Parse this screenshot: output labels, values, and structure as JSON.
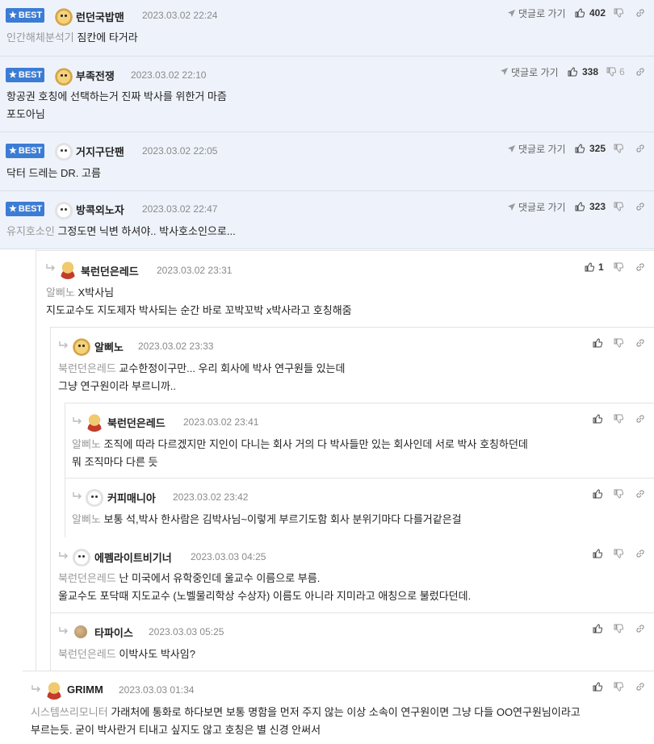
{
  "best_comments": [
    {
      "badge": "BEST",
      "nick": "런던국밥맨",
      "date": "2023.03.02 22:24",
      "reply_link": "댓글로 가기",
      "likes": "402",
      "dislikes": "",
      "mention": "인간해체분석기",
      "lines": [
        "짐칸에 타거라"
      ]
    },
    {
      "badge": "BEST",
      "nick": "부족전쟁",
      "date": "2023.03.02 22:10",
      "reply_link": "댓글로 가기",
      "likes": "338",
      "dislikes": "6",
      "mention": "",
      "lines": [
        "항공권 호칭에 선택하는거 진짜 박사를 위한거 마즘",
        "포도아님"
      ]
    },
    {
      "badge": "BEST",
      "nick": "거지구단팬",
      "date": "2023.03.02 22:05",
      "reply_link": "댓글로 가기",
      "likes": "325",
      "dislikes": "",
      "mention": "",
      "lines": [
        "닥터 드레는 DR. 고름"
      ]
    },
    {
      "badge": "BEST",
      "nick": "방콕외노자",
      "date": "2023.03.02 22:47",
      "reply_link": "댓글로 가기",
      "likes": "323",
      "dislikes": "",
      "mention": "유지호소인",
      "lines": [
        "그정도면 닉변 하셔야.. 박사호소인으로..."
      ]
    }
  ],
  "replies": [
    {
      "nick": "북런던은레드",
      "date": "2023.03.02 23:31",
      "likes": "1",
      "mention": "알삐노",
      "lines": [
        "X박사님",
        "지도교수도 지도제자 박사되는 순간 바로 꼬박꼬박 x박사라고 호칭해줌"
      ]
    },
    {
      "nick": "알삐노",
      "date": "2023.03.02 23:33",
      "likes": "",
      "mention": "북런던은레드",
      "lines": [
        "교수한정이구만... 우리 회사에 박사 연구원들 있는데",
        "그냥 연구원이라 부르니까.."
      ]
    },
    {
      "nick": "북런던은레드",
      "date": "2023.03.02 23:41",
      "likes": "",
      "mention": "알삐노",
      "lines": [
        "조직에 따라 다르겠지만 지인이 다니는 회사 거의 다 박사들만 있는 회사인데 서로 박사 호칭하던데",
        "뭐 조직마다 다른 듯"
      ]
    },
    {
      "nick": "커피매니아",
      "date": "2023.03.02 23:42",
      "likes": "",
      "mention": "알삐노",
      "lines": [
        "보통 석,박사 한사람은 김박사님~이렇게 부르기도함 회사 분위기마다 다를거같은걸"
      ]
    },
    {
      "nick": "에펨라이트비기너",
      "date": "2023.03.03 04:25",
      "likes": "",
      "mention": "북런던은레드",
      "lines": [
        "난 미국에서 유학중인데 울교수 이름으로 부름.",
        "울교수도 포닥때 지도교수 (노벨물리학상 수상자) 이름도 아니라 지미라고 애칭으로 불렀다던데."
      ]
    },
    {
      "nick": "타파이스",
      "date": "2023.03.03 05:25",
      "likes": "",
      "mention": "북런던은레드",
      "lines": [
        "이박사도 박사임?"
      ]
    },
    {
      "nick": "GRIMM",
      "date": "2023.03.03 01:34",
      "likes": "",
      "mention": "시스템쓰리모니터",
      "lines": [
        "가래처에 통화로 하다보면 보통 명함을 먼저 주지 않는 이상 소속이 연구원이면 그냥 다들 OO연구원님이라고",
        "부르는듯. 굳이 박사란거 티내고 싶지도 않고 호칭은 별 신경 안써서"
      ]
    }
  ],
  "colors": {
    "best_bg": "#eef3fb",
    "badge": "#3c7cd4",
    "mention": "#999999"
  }
}
